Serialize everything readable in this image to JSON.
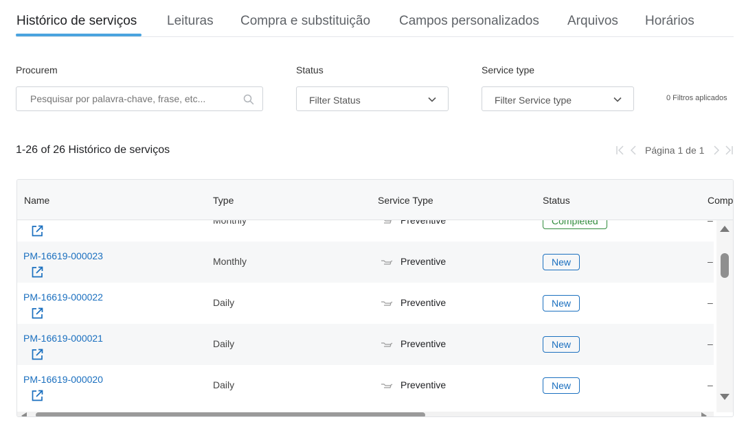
{
  "tabs": [
    {
      "label": "Histórico de serviços",
      "active": true
    },
    {
      "label": "Leituras",
      "active": false
    },
    {
      "label": "Compra e substituição",
      "active": false
    },
    {
      "label": "Campos personalizados",
      "active": false
    },
    {
      "label": "Arquivos",
      "active": false
    },
    {
      "label": "Horários",
      "active": false
    }
  ],
  "filters": {
    "search_label": "Procurem",
    "search_placeholder": "Pesquisar por palavra-chave, frase, etc...",
    "status_label": "Status",
    "status_placeholder": "Filter Status",
    "service_type_label": "Service type",
    "service_type_placeholder": "Filter Service type",
    "applied": "0 Filtros aplicados"
  },
  "results": {
    "count_text": "1-26 of 26 Histórico de serviços",
    "page_text": "Página 1 de 1"
  },
  "table": {
    "columns": [
      "Name",
      "Type",
      "Service Type",
      "Status",
      "Comp"
    ],
    "partial_row": {
      "type": "Monthly",
      "service_type": "Preventive",
      "status": "Completed",
      "comp": "–"
    },
    "rows": [
      {
        "name": "PM-16619-000023",
        "type": "Monthly",
        "service_type": "Preventive",
        "status": "New",
        "comp": "–"
      },
      {
        "name": "PM-16619-000022",
        "type": "Daily",
        "service_type": "Preventive",
        "status": "New",
        "comp": "–"
      },
      {
        "name": "PM-16619-000021",
        "type": "Daily",
        "service_type": "Preventive",
        "status": "New",
        "comp": "–"
      },
      {
        "name": "PM-16619-000020",
        "type": "Daily",
        "service_type": "Preventive",
        "status": "New",
        "comp": "–"
      }
    ]
  },
  "icons": {
    "search": "search-icon",
    "dropdown": "chevron-down-icon",
    "external_link": "external-link-icon",
    "service_type": "oil-can-icon"
  },
  "colors": {
    "accent": "#4aa3df",
    "link": "#1a6fbf",
    "status_new": "#1a6fbf",
    "status_completed": "#2e8b3a"
  }
}
